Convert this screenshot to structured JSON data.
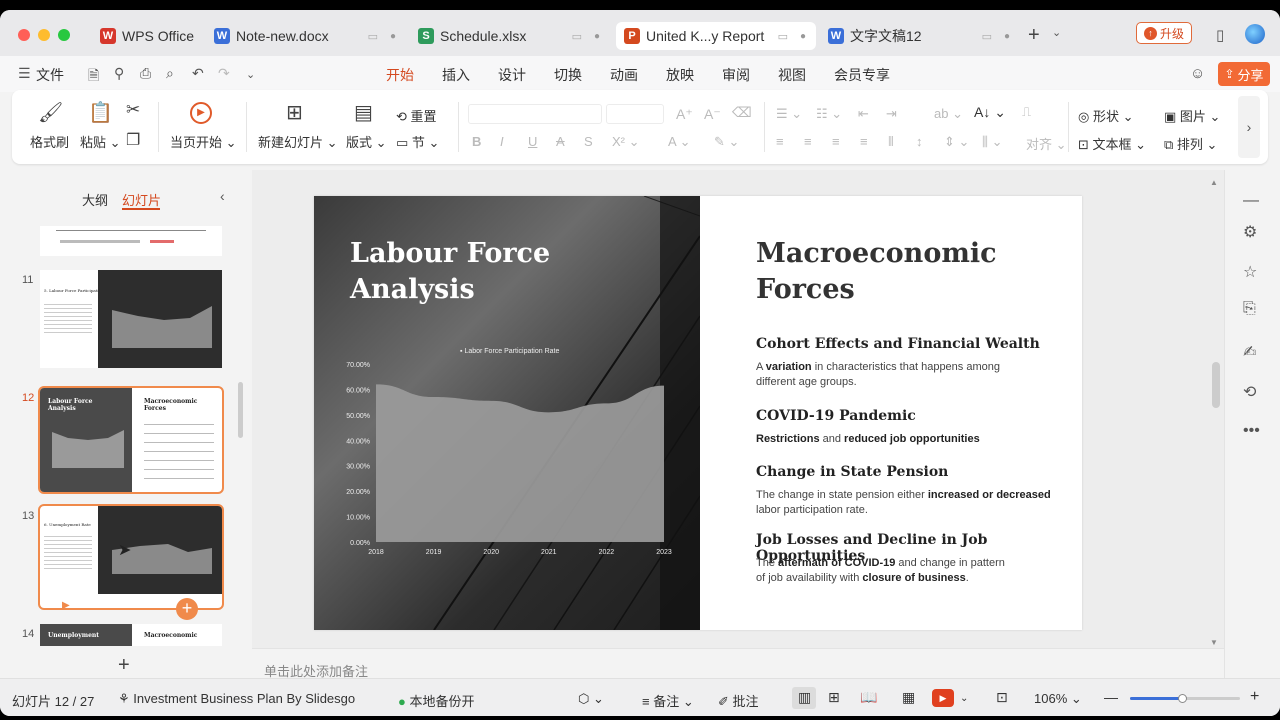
{
  "tabs": [
    {
      "label": "WPS Office",
      "icon": "W",
      "color": "#d6372c"
    },
    {
      "label": "Note-new.docx",
      "icon": "W",
      "color": "#3b6fd8"
    },
    {
      "label": "Schedule.xlsx",
      "icon": "S",
      "color": "#2e9b5c"
    },
    {
      "label": "United K...y Report",
      "icon": "P",
      "color": "#d4491f"
    },
    {
      "label": "文字文稿12",
      "icon": "W",
      "color": "#3b6fd8"
    }
  ],
  "titlebar": {
    "upgrade": "升级"
  },
  "menu": {
    "file": "文件",
    "tabs": [
      "开始",
      "插入",
      "设计",
      "切换",
      "动画",
      "放映",
      "审阅",
      "视图",
      "会员专享"
    ],
    "share": "分享"
  },
  "ribbon": {
    "format_painter": "格式刷",
    "paste": "粘贴",
    "from_current": "当页开始",
    "new_slide": "新建幻灯片",
    "layout": "版式",
    "reset": "重置",
    "section": "节",
    "align": "对齐",
    "shape": "形状",
    "picture": "图片",
    "textbox": "文本框",
    "arrange": "排列"
  },
  "panel": {
    "outline": "大纲",
    "slides": "幻灯片",
    "nums": [
      "11",
      "12",
      "13",
      "14"
    ],
    "t11_title": "5. Labour Force Participation",
    "t12_left": "Labour Force Analysis",
    "t12_right": "Macroeconomic Forces",
    "t13_title": "6. Unemployment Rate",
    "t14_left": "Unemployment",
    "t14_right": "Macroeconomic"
  },
  "slide": {
    "left_title": "Labour Force Analysis",
    "title": "Macroeconomic Forces",
    "items": [
      {
        "heading": "Cohort Effects and Financial Wealth",
        "body_html": "A <b>variation</b> in characteristics that happens among different age groups."
      },
      {
        "heading": "COVID-19 Pandemic",
        "body_html": "<b>Restrictions</b> and <b>reduced job opportunities</b>"
      },
      {
        "heading": "Change in State Pension",
        "body_html": "The change in state pension either <b>increased or decreased</b> labor participation rate."
      },
      {
        "heading": "Job Losses and Decline in Job Opportunities",
        "body_html": "The <b>aftermath of COVID-19</b> and change in pattern of job availability with <b>closure of business</b>."
      }
    ]
  },
  "chart_data": {
    "type": "area",
    "legend": "Labor Force Participation Rate",
    "x": [
      2018,
      2019,
      2020,
      2021,
      2022,
      2023
    ],
    "y_ticks": [
      "0.00%",
      "10.00%",
      "20.00%",
      "30.00%",
      "40.00%",
      "50.00%",
      "60.00%",
      "70.00%"
    ],
    "values": [
      62.0,
      57.0,
      55.5,
      51.0,
      54.5,
      61.5
    ],
    "ylim": [
      0,
      70
    ],
    "grid": false
  },
  "notes": {
    "placeholder": "单击此处添加备注"
  },
  "status": {
    "slide_counter": "幻灯片 12 / 27",
    "template": "Investment Business Plan By Slidesgo",
    "backup": "本地备份开",
    "notes": "备注",
    "comments": "批注",
    "zoom": "106%"
  }
}
